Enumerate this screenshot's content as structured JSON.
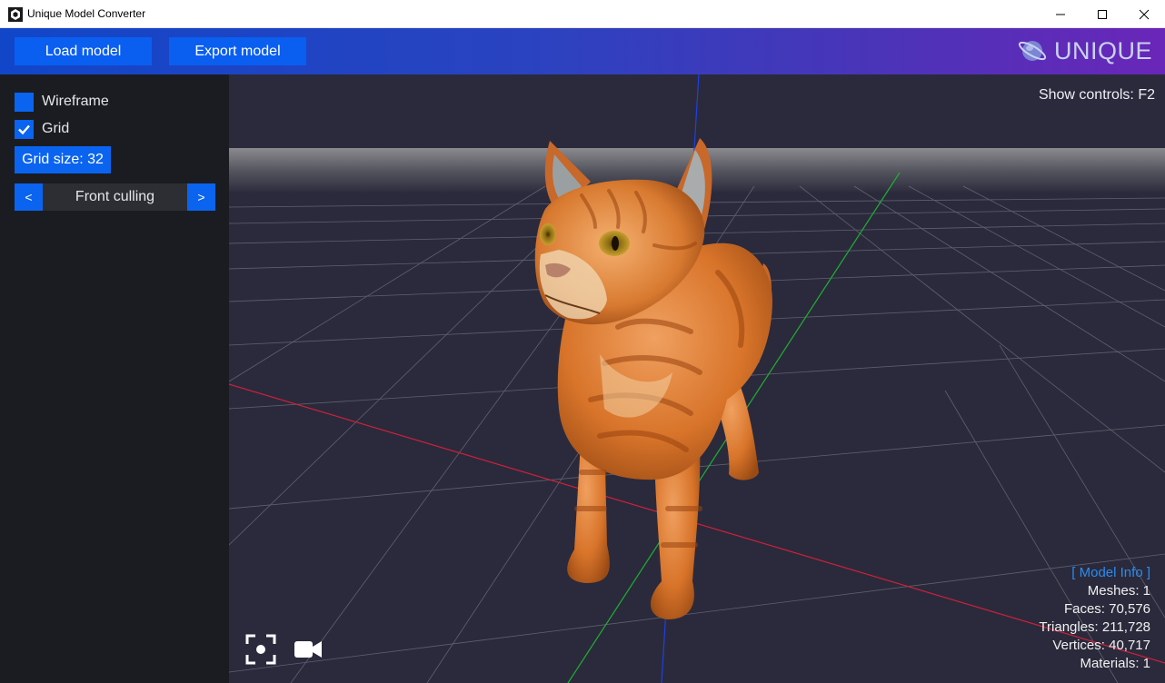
{
  "window": {
    "title": "Unique Model Converter",
    "controls": [
      "minimize",
      "maximize",
      "close"
    ]
  },
  "toolbar": {
    "load_label": "Load model",
    "export_label": "Export model",
    "logo_text": "UNIQUE"
  },
  "panel": {
    "wireframe": {
      "label": "Wireframe",
      "checked": false
    },
    "grid": {
      "label": "Grid",
      "checked": true
    },
    "grid_size_label": "Grid size: 32",
    "culling": {
      "prev_label": "<",
      "value": "Front culling",
      "next_label": ">"
    }
  },
  "viewport": {
    "show_controls": "Show controls: F2",
    "model": "cat",
    "icons": [
      "focus-icon",
      "camera-icon"
    ]
  },
  "model_info": {
    "header": "[ Model Info ]",
    "meshes": "Meshes: 1",
    "faces": "Faces: 70,576",
    "triangles": "Triangles: 211,728",
    "vertices": "Vertices: 40,717",
    "materials": "Materials: 1"
  },
  "colors": {
    "accent": "#0a64f0",
    "toolbar_start": "#1146c8",
    "toolbar_end": "#6a26b8",
    "viewport_bg": "#2a2a3c",
    "panel_bg": "#191b20",
    "info_header": "#2a8cf0",
    "axis_x": "#d0203a",
    "axis_y": "#2040e0",
    "axis_z": "#20b030"
  }
}
